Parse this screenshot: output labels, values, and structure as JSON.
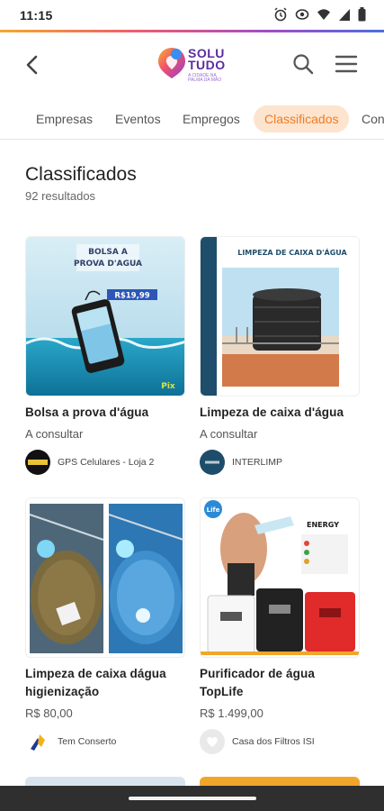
{
  "status": {
    "time": "11:15"
  },
  "header": {
    "logo_line1": "SOLU",
    "logo_line2": "TUDO",
    "logo_tagline": "A CIDADE NA PALMA DA MÃO"
  },
  "tabs": [
    {
      "label": "Empresas",
      "active": false
    },
    {
      "label": "Eventos",
      "active": false
    },
    {
      "label": "Empregos",
      "active": false
    },
    {
      "label": "Classificados",
      "active": true
    },
    {
      "label": "Con",
      "active": false
    }
  ],
  "page": {
    "title": "Classificados",
    "count": "92 resultados"
  },
  "listings": [
    {
      "title": "Bolsa a prova d'água",
      "price": "A consultar",
      "seller": "GPS Celulares - Loja 2",
      "image_caption": "BOLSA A PROVA D'AGUA",
      "image_price": "R$19,99"
    },
    {
      "title": "Limpeza de caixa d'água",
      "price": "A consultar",
      "seller": "INTERLIMP",
      "image_caption": "LIMPEZA DE CAIXA D'ÁGUA"
    },
    {
      "title": "Limpeza de caixa dágua higienização",
      "price": "R$ 80,00",
      "seller": "Tem Conserto"
    },
    {
      "title": "Purificador de água TopLife",
      "price": "R$ 1.499,00",
      "seller": "Casa dos Filtros ISI",
      "image_caption": "ENERGY"
    }
  ],
  "colors": {
    "accent": "#f07c1f",
    "accent_bg": "#fde4cf",
    "brand_purple": "#5b2ca0"
  }
}
